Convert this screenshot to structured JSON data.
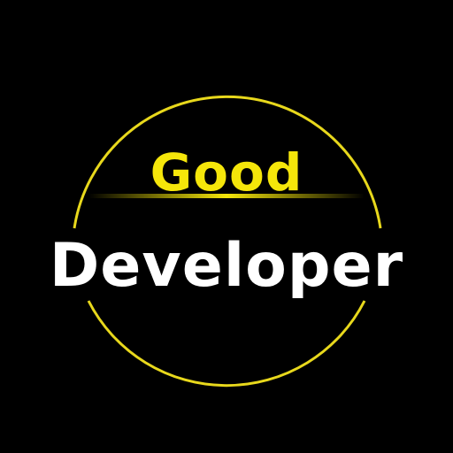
{
  "logo": {
    "line1": "Good",
    "line2": "Developer"
  },
  "colors": {
    "background": "#000000",
    "accent": "#f5e60a",
    "text": "#ffffff"
  }
}
